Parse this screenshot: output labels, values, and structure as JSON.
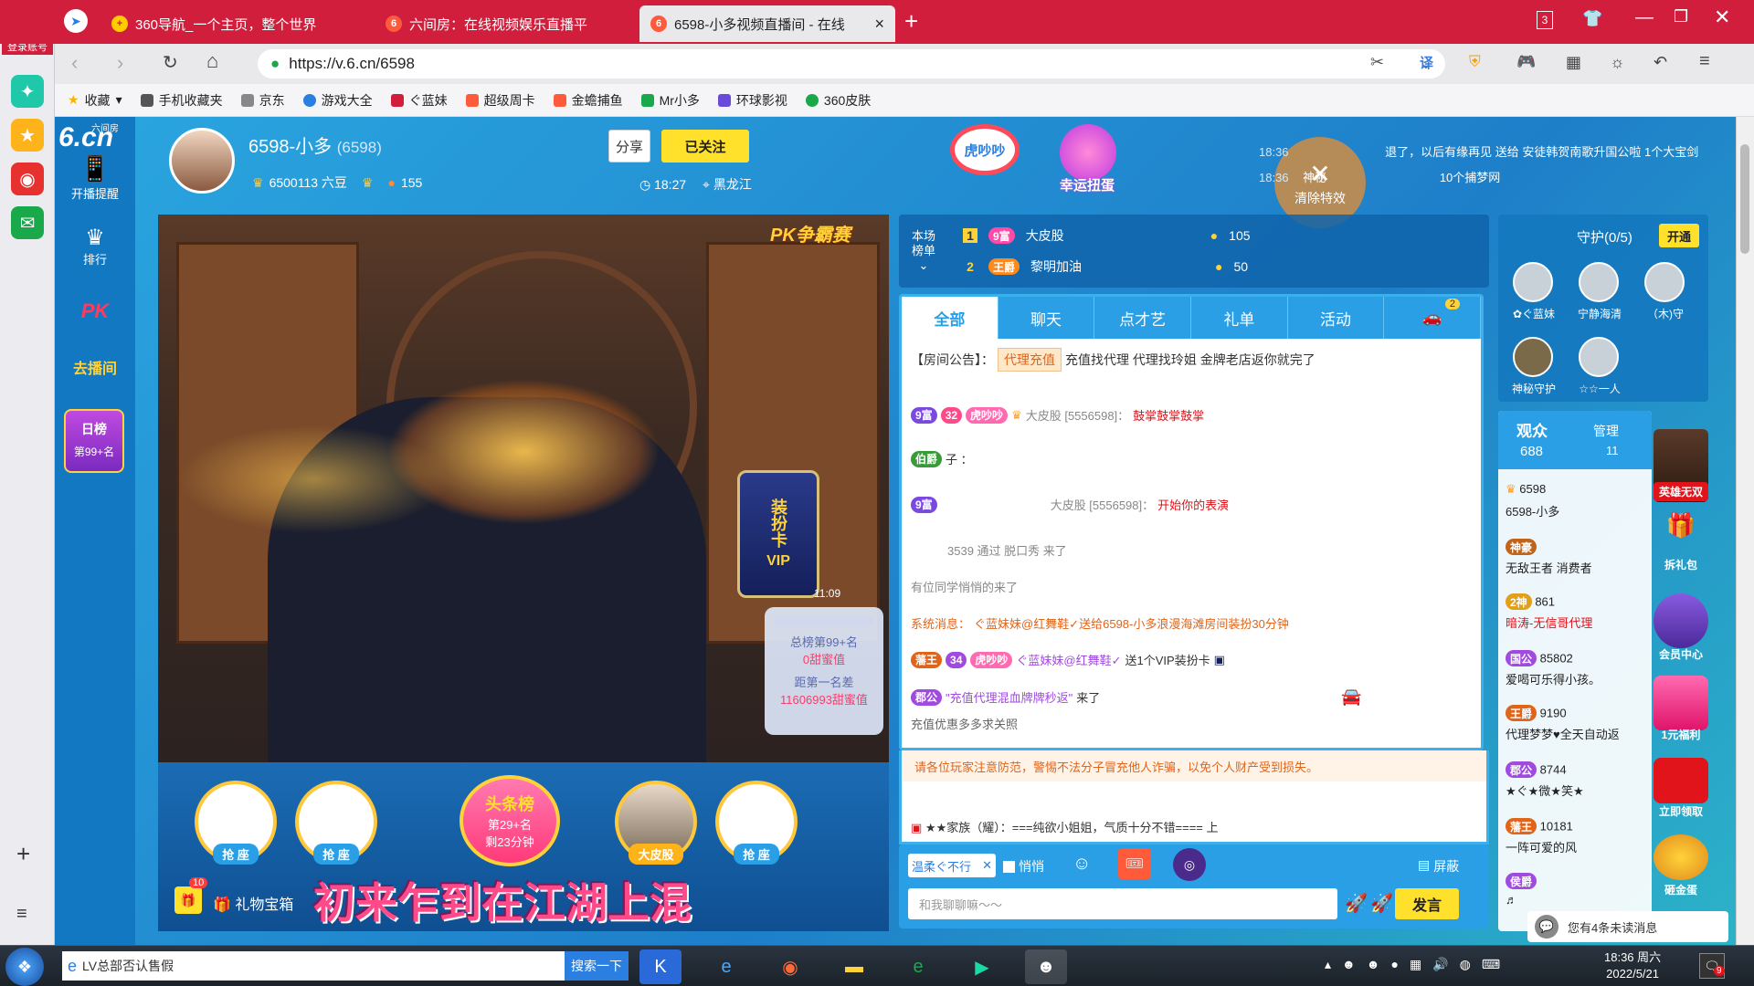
{
  "browser": {
    "account_label": "登录账号",
    "tabs": [
      {
        "title": "360导航_一个主页，整个世界"
      },
      {
        "title": "六间房：在线视频娱乐直播平"
      },
      {
        "title": "6598-小多视频直播间 - 在线"
      }
    ],
    "url": "https://v.6.cn/6598",
    "tab_count": "3",
    "bookmarks": [
      "收藏",
      "手机收藏夹",
      "京东",
      "游戏大全",
      "ぐ蓝妹",
      "超级周卡",
      "金蟾捕鱼",
      "Mr小多",
      "环球影视",
      "360皮肤"
    ]
  },
  "site": {
    "logo": "6.cn",
    "logo_sub": "六间房",
    "side": [
      {
        "label": "开播提醒"
      },
      {
        "label": "排行"
      },
      {
        "label": "PK"
      },
      {
        "label": "去播间"
      },
      {
        "label": "日榜"
      },
      {
        "label": "第99+名"
      }
    ]
  },
  "anchor": {
    "name": "6598-小多",
    "room_id": "(6598)",
    "coins": "6500113 六豆",
    "fans": "155",
    "share_label": "分享",
    "follow_label": "已关注",
    "time": "18:27",
    "location": "黑龙江"
  },
  "activity": {
    "hupao": "虎吵吵",
    "lucky": "幸运扭蛋",
    "clear_effects": "清除特效",
    "ticker": [
      {
        "time": "18:36",
        "text": "退了，以后有缘再见 送给 安徒韩贺南歌升国公啦 1个大宝剑"
      },
      {
        "time": "18:36",
        "text": "神秘",
        "extra": "10个捕梦网"
      }
    ]
  },
  "video": {
    "pk_label": "PK争霸赛",
    "card_label": "装扮卡",
    "vip": "VIP",
    "rank_total": "总榜第99+名",
    "sweet": "0甜蜜值",
    "gap_label": "距第一名差",
    "gap_value": "11606993甜蜜值",
    "timer": "11:09"
  },
  "rank": {
    "label1": "本场",
    "label2": "榜单",
    "rows": [
      {
        "rank": "1",
        "badge": "9富",
        "name": "大皮股",
        "score": "105"
      },
      {
        "rank": "2",
        "badge": "王爵",
        "name": "黎明加油",
        "score": "50"
      }
    ]
  },
  "chat": {
    "tabs": [
      "全部",
      "聊天",
      "点才艺",
      "礼单",
      "活动"
    ],
    "car_count": "2",
    "notice_label": "【房间公告】：",
    "notice_tag": "代理充值",
    "notice_text": "充值找代理 代理找玲姐 金牌老店返你就完了",
    "messages": [
      {
        "badge": "9富",
        "level": "32",
        "club": "虎吵吵",
        "name": "大皮股 [5556598]：",
        "text": "鼓掌鼓掌鼓掌"
      },
      {
        "badge": "伯爵",
        "text": "子  ："
      },
      {
        "badge": "9富",
        "name": "大皮股 [5556598]：",
        "text": "开始你的表演"
      },
      {
        "text": "3539 通过 脱口秀 来了"
      },
      {
        "text": "有位同学悄悄的来了"
      },
      {
        "system": "系统消息：",
        "text": "ぐ蓝妹妹@红舞鞋✓送给6598-小多浪漫海滩房间装扮30分钟"
      },
      {
        "badge": "藩王",
        "level": "34",
        "club": "虎吵吵",
        "name": "ぐ蓝妹妹@红舞鞋✓",
        "text": "送1个VIP装扮卡"
      },
      {
        "badge": "郡公",
        "name": "\"充值代理混血牌牌秒返\"",
        "text": "来了"
      },
      {
        "text": "充值优惠多多求关照"
      }
    ],
    "warning": "请各位玩家注意防范，警惕不法分子冒充他人诈骗，以免个人财产受到损失。",
    "family_msg": "★★家族（耀）：===纯欲小姐姐，气质十分不错==== 上",
    "tag_select": "温柔ぐ不行",
    "whisper": "悄悄",
    "block": "屏蔽",
    "placeholder": "和我聊聊嘛～～",
    "send": "发言",
    "gift_box": "礼物宝箱",
    "gift_count": "10",
    "banner": "初来乍到在江湖上混"
  },
  "seats": {
    "grab": "抢 座",
    "headline": "头条榜",
    "headline_rank": "第29+名",
    "headline_time": "剩23分钟",
    "seat4_name": "大皮股"
  },
  "guard": {
    "title": "守护(0/5)",
    "open": "开通",
    "members": [
      "✿ぐ蓝妹",
      "宁静海清",
      "（木)守",
      "神秘守护",
      "☆☆一人"
    ]
  },
  "audience": {
    "viewers_label": "观众",
    "viewers": "688",
    "admin_label": "管理",
    "admin": "11",
    "list": [
      {
        "score": "6598",
        "name": "6598-小多"
      },
      {
        "badge": "神豪",
        "name": "无敌王者 消费者"
      },
      {
        "badge": "2神",
        "score": "861",
        "name": "暗涛-无信哥代理"
      },
      {
        "badge": "国公",
        "score": "85802",
        "name": "爱喝可乐得小孩。"
      },
      {
        "badge": "王爵",
        "score": "9190",
        "name": "代理梦梦♥全天自动返"
      },
      {
        "badge": "郡公",
        "score": "8744",
        "name": "★ぐ★微★笑★"
      },
      {
        "badge": "藩王",
        "score": "10181",
        "name": "一阵可爱的风"
      },
      {
        "badge": "侯爵",
        "name": "♬"
      }
    ],
    "unread": "您有4条未读消息"
  },
  "promos": [
    "英雄无双",
    "拆礼包",
    "会员中心",
    "1元福利",
    "立即领取",
    "砸金蛋"
  ],
  "taskbar": {
    "search_text": "LV总部否认售假",
    "search_btn": "搜索一下",
    "time": "18:36 周六",
    "date": "2022/5/21",
    "notif": "9"
  }
}
